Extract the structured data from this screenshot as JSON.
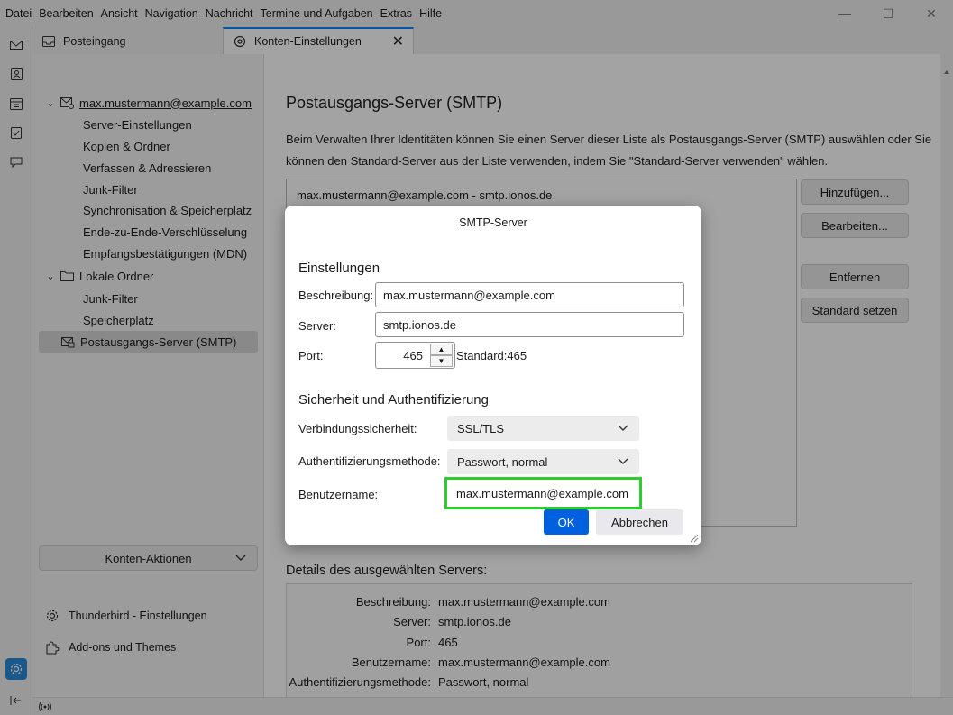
{
  "menu": [
    "Datei",
    "Bearbeiten",
    "Ansicht",
    "Navigation",
    "Nachricht",
    "Termine und Aufgaben",
    "Extras",
    "Hilfe"
  ],
  "tabs": [
    {
      "label": "Posteingang"
    },
    {
      "label": "Konten-Einstellungen"
    }
  ],
  "sidebar": {
    "account": "max.mustermann@example.com",
    "account_items": [
      "Server-Einstellungen",
      "Kopien & Ordner",
      "Verfassen & Adressieren",
      "Junk-Filter",
      "Synchronisation & Speicherplatz",
      "Ende-zu-Ende-Verschlüsselung",
      "Empfangsbestätigungen (MDN)"
    ],
    "local_folders": "Lokale Ordner",
    "local_items": [
      "Junk-Filter",
      "Speicherplatz"
    ],
    "smtp": "Postausgangs-Server (SMTP)",
    "account_actions": "Konten-Aktionen",
    "settings_link": "Thunderbird - Einstellungen",
    "addons_link": "Add-ons und Themes"
  },
  "main": {
    "title": "Postausgangs-Server (SMTP)",
    "description": "Beim Verwalten Ihrer Identitäten können Sie einen Server dieser Liste als Postausgangs-Server (SMTP) auswählen oder Sie können den Standard-Server aus der Liste verwenden, indem Sie \"Standard-Server verwenden\" wählen.",
    "server_list": [
      "max.mustermann@example.com - smtp.ionos.de"
    ],
    "buttons": {
      "add": "Hinzufügen...",
      "edit": "Bearbeiten...",
      "remove": "Entfernen",
      "set_default": "Standard setzen"
    },
    "details_title": "Details des ausgewählten Servers:",
    "details": [
      {
        "k": "Beschreibung:",
        "v": "max.mustermann@example.com"
      },
      {
        "k": "Server:",
        "v": "smtp.ionos.de"
      },
      {
        "k": "Port:",
        "v": "465"
      },
      {
        "k": "Benutzername:",
        "v": "max.mustermann@example.com"
      },
      {
        "k": "Authentifizierungsmethode:",
        "v": "Passwort, normal"
      }
    ]
  },
  "dialog": {
    "title": "SMTP-Server",
    "section_settings": "Einstellungen",
    "description_label": "Beschreibung:",
    "description_value": "max.mustermann@example.com",
    "server_label": "Server:",
    "server_value": "smtp.ionos.de",
    "port_label": "Port:",
    "port_value": "465",
    "port_default": "Standard:465",
    "section_security": "Sicherheit und Authentifizierung",
    "conn_security_label": "Verbindungssicherheit:",
    "conn_security_value": "SSL/TLS",
    "auth_label": "Authentifizierungsmethode:",
    "auth_value": "Passwort, normal",
    "username_label": "Benutzername:",
    "username_value": "max.mustermann@example.com",
    "ok": "OK",
    "cancel": "Abbrechen"
  },
  "colors": {
    "accent": "#0060df",
    "highlight": "#2fcc2f",
    "active_space": "#2b8ad8"
  }
}
